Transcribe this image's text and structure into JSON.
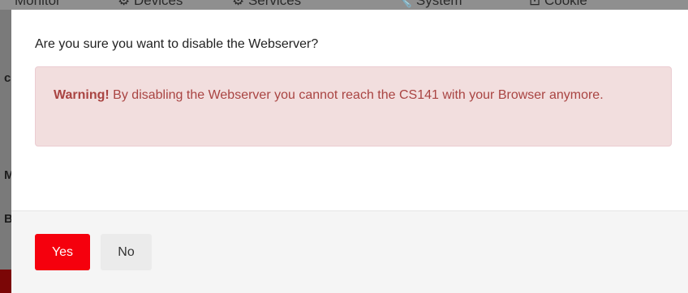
{
  "background": {
    "nav_items": [
      "Monitor",
      "Devices",
      "Services",
      "System",
      "Cookie"
    ],
    "fragments": [
      "c",
      "M",
      "B"
    ]
  },
  "modal": {
    "title": "Are you sure you want to disable the Webserver?",
    "alert": {
      "strong": "Warning!",
      "text": " By disabling the Webserver you cannot reach the CS141 with your Browser anymore."
    },
    "buttons": {
      "yes": "Yes",
      "no": "No"
    }
  },
  "colors": {
    "yes_button": "#f5000d",
    "alert_bg": "#f2dede",
    "alert_text": "#a94442",
    "backdrop": "#6d6d6d"
  }
}
